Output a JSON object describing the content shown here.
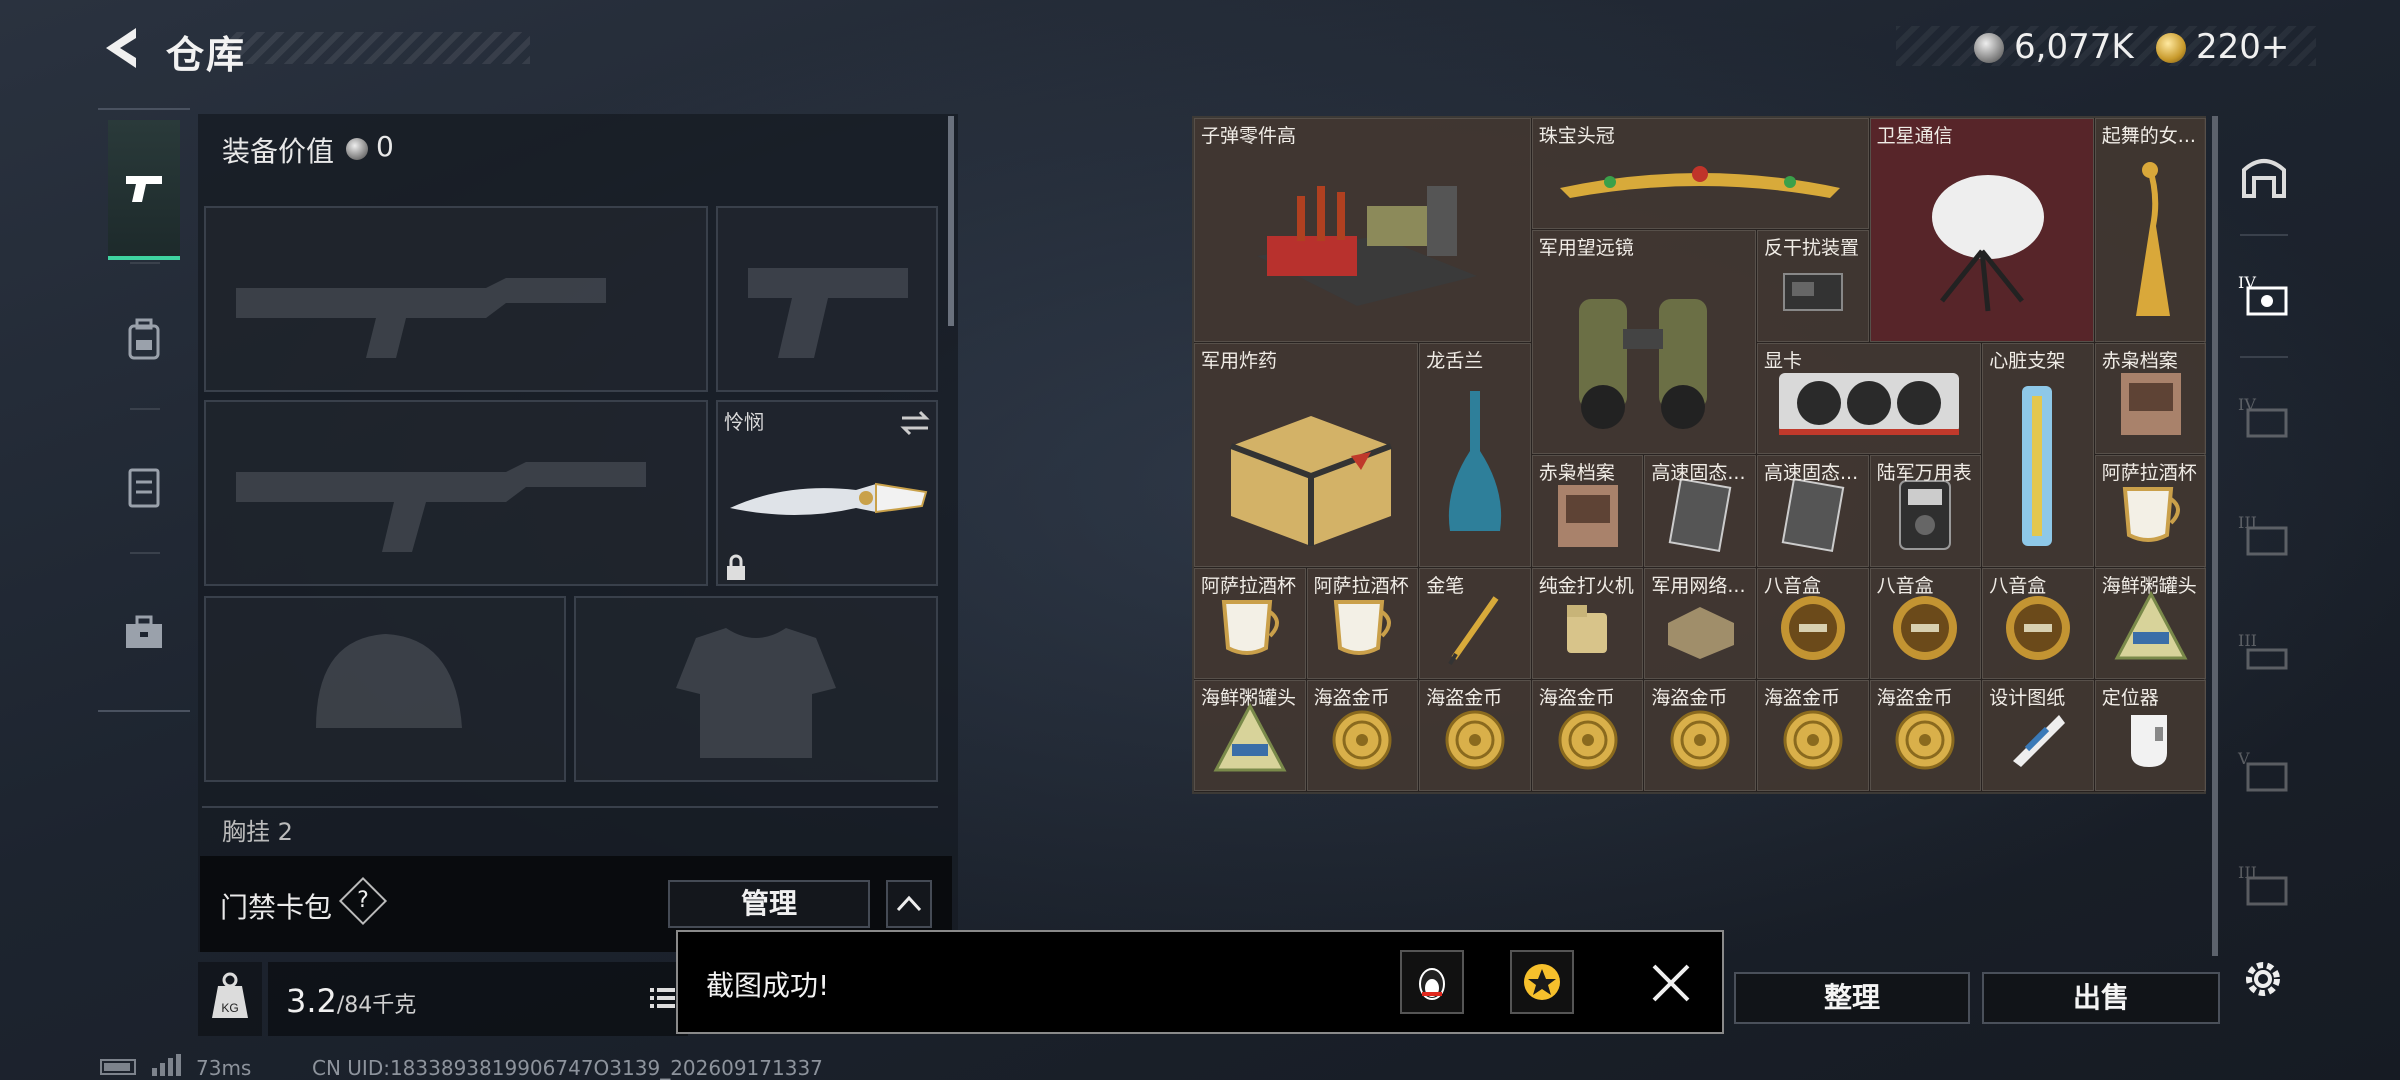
{
  "header": {
    "title": "仓库",
    "money": "6,077K",
    "gold": "220+"
  },
  "equipment": {
    "value_label": "装备价值",
    "value": "0",
    "melee_slot_label": "怜悯",
    "chest_label": "胸挂",
    "chest_count": "2"
  },
  "card_pack": {
    "label": "门禁卡包",
    "help": "?",
    "manage_label": "管理"
  },
  "weight": {
    "kg_icon": "KG",
    "current": "3.2",
    "max": "/84千克"
  },
  "footer": {
    "ping": "73ms",
    "uid": "CN UID:1833893819906747O3139_202609171337"
  },
  "stash": {
    "items": [
      {
        "name": "子弹零件高"
      },
      {
        "name": "珠宝头冠"
      },
      {
        "name": "卫星通信"
      },
      {
        "name": "起舞的女..."
      },
      {
        "name": "军用望远镜"
      },
      {
        "name": "反干扰装置"
      },
      {
        "name": "军用炸药"
      },
      {
        "name": "龙舌兰"
      },
      {
        "name": "显卡"
      },
      {
        "name": "心脏支架"
      },
      {
        "name": "赤枭档案"
      },
      {
        "name": "赤枭档案"
      },
      {
        "name": "高速固态..."
      },
      {
        "name": "高速固态..."
      },
      {
        "name": "陆军万用表"
      },
      {
        "name": "阿萨拉酒杯"
      },
      {
        "name": "阿萨拉酒杯"
      },
      {
        "name": "阿萨拉酒杯"
      },
      {
        "name": "金笔"
      },
      {
        "name": "纯金打火机"
      },
      {
        "name": "军用网络..."
      },
      {
        "name": "八音盒"
      },
      {
        "name": "八音盒"
      },
      {
        "name": "八音盒"
      },
      {
        "name": "海鲜粥罐头"
      },
      {
        "name": "海鲜粥罐头"
      },
      {
        "name": "海盗金币"
      },
      {
        "name": "海盗金币"
      },
      {
        "name": "海盗金币"
      },
      {
        "name": "海盗金币"
      },
      {
        "name": "海盗金币"
      },
      {
        "name": "海盗金币"
      },
      {
        "name": "设计图纸"
      },
      {
        "name": "定位器"
      }
    ]
  },
  "actions": {
    "sort_label": "整理",
    "sell_label": "出售"
  },
  "toast": {
    "message": "截图成功!"
  },
  "colors": {
    "accent": "#3fd3a0",
    "stash_bg": "#3a312b",
    "rare_red": "#60262c"
  }
}
